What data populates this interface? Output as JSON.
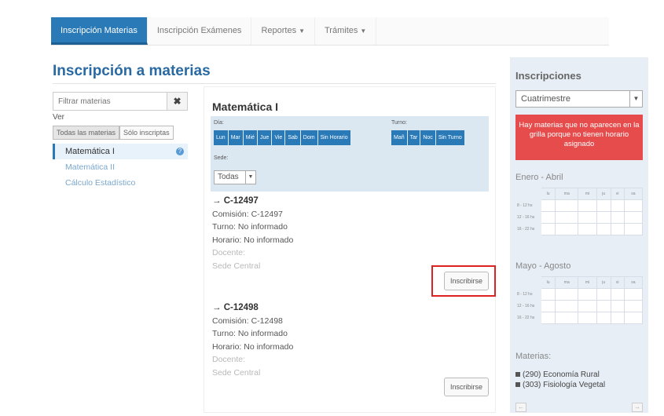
{
  "nav": {
    "tabs": [
      {
        "label": "Inscripción Materias"
      },
      {
        "label": "Inscripción Exámenes"
      },
      {
        "label": "Reportes",
        "caret": "▼"
      },
      {
        "label": "Trámites",
        "caret": "▼"
      }
    ]
  },
  "page": {
    "title": "Inscripción a materias"
  },
  "left": {
    "filter_placeholder": "Filtrar materias",
    "clear_icon": "✖",
    "ver_label": "Ver",
    "view_toggle": [
      "Todas las materias",
      "Sólo inscriptas"
    ],
    "materias": [
      {
        "label": "Matemática I",
        "help": "?"
      },
      {
        "label": "Matemática II"
      },
      {
        "label": "Cálculo Estadístico"
      }
    ]
  },
  "subject": {
    "title": "Matemática I",
    "dia_label": "Día:",
    "dias": [
      "Lun",
      "Mar",
      "Mié",
      "Jue",
      "Vie",
      "Sab",
      "Dom",
      "Sin Horario"
    ],
    "turno_label": "Turno:",
    "turnos": [
      "Mañ",
      "Tar",
      "Noc",
      "Sin Turno"
    ],
    "sede_label": "Sede:",
    "sede_value": "Todas",
    "select_arrow": "▼",
    "comisiones": [
      {
        "header": "→ C-12497",
        "comision": "Comisión: C-12497",
        "turno": "Turno: No informado",
        "horario": "Horario: No informado",
        "docente": "Docente:",
        "sede": "Sede Central",
        "button": "Inscribirse"
      },
      {
        "header": "→ C-12498",
        "comision": "Comisión: C-12498",
        "turno": "Turno: No informado",
        "horario": "Horario: No informado",
        "docente": "Docente:",
        "sede": "Sede Central",
        "button": "Inscribirse"
      }
    ]
  },
  "sidebar": {
    "title": "Inscripciones",
    "period": "Cuatrimestre",
    "alert": "Hay materias que no aparecen en la grilla porque no tienen horario asignado",
    "grids": [
      {
        "title": "Enero - Abril",
        "days": [
          "lu",
          "ma",
          "mi",
          "ju",
          "vi",
          "sa"
        ],
        "rows": [
          "8 - 12 hs",
          "12 - 16 hs",
          "16 - 22 hs"
        ]
      },
      {
        "title": "Mayo - Agosto",
        "days": [
          "lu",
          "ma",
          "mi",
          "ju",
          "vi",
          "sa"
        ],
        "rows": [
          "8 - 12 hs",
          "12 - 16 hs",
          "16 - 22 hs"
        ]
      }
    ],
    "materias_title": "Materias:",
    "materias": [
      "(290) Economía Rural",
      "(303) Fisiología Vegetal"
    ],
    "prev": "←",
    "next": "→",
    "alert_color": "#e64c4c"
  },
  "colors": {
    "accent": "#2a7ab8",
    "title": "#2a6aa3",
    "highlight": "#dd2222"
  }
}
